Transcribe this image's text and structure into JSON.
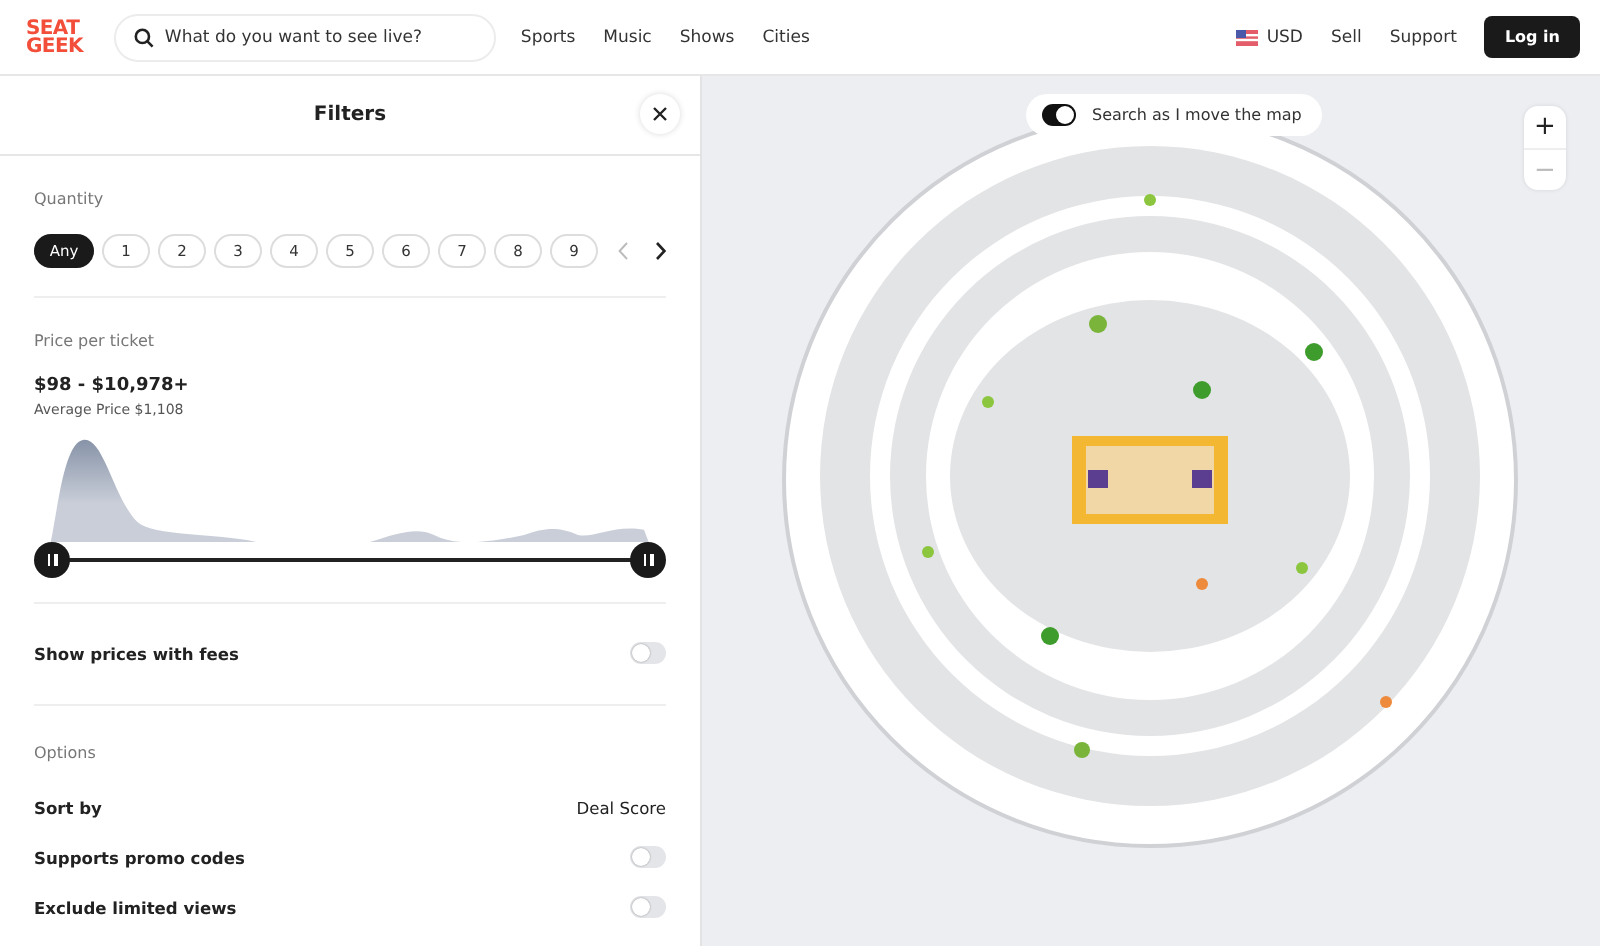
{
  "header": {
    "logo": [
      "SEAT",
      "GEEK"
    ],
    "search": {
      "placeholder": "What do you want to see live?"
    },
    "nav": [
      "Sports",
      "Music",
      "Shows",
      "Cities"
    ],
    "currency": "USD",
    "links": [
      "Sell",
      "Support"
    ],
    "login": "Log in"
  },
  "filters": {
    "title": "Filters",
    "quantity": {
      "label": "Quantity",
      "options": [
        {
          "label": "Any",
          "selected": true
        },
        {
          "label": "1",
          "selected": false
        },
        {
          "label": "2",
          "selected": false
        },
        {
          "label": "3",
          "selected": false
        },
        {
          "label": "4",
          "selected": false
        },
        {
          "label": "5",
          "selected": false
        },
        {
          "label": "6",
          "selected": false
        },
        {
          "label": "7",
          "selected": false
        },
        {
          "label": "8",
          "selected": false
        },
        {
          "label": "9",
          "selected": false
        }
      ],
      "prev_disabled": true
    },
    "price": {
      "label": "Price per ticket",
      "range": "$98 - $10,978+",
      "average": "Average Price $1,108",
      "selection": {
        "level": 1
      }
    },
    "fees": {
      "label": "Show prices with fees",
      "on": false
    },
    "options": {
      "label": "Options",
      "rows": [
        {
          "kind": "value",
          "label": "Sort by",
          "value": "Deal Score"
        },
        {
          "kind": "toggle",
          "label": "Supports promo codes",
          "on": false
        },
        {
          "kind": "toggle",
          "label": "Exclude limited views",
          "on": false
        }
      ]
    }
  },
  "map": {
    "search_toggle": {
      "label": "Search as I move the map",
      "on": true
    },
    "zoom": [
      {
        "label": "+",
        "disabled": false
      },
      {
        "label": "−",
        "disabled": true
      }
    ]
  }
}
